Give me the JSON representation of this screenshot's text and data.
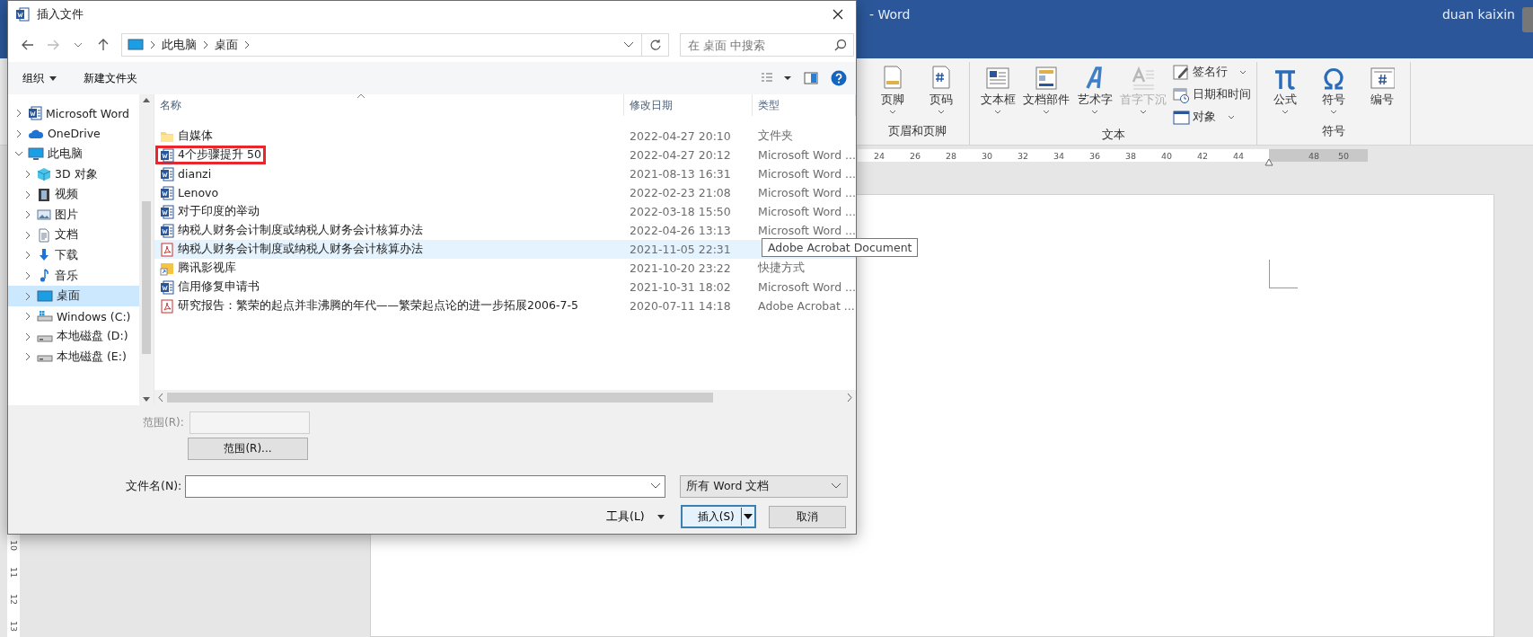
{
  "word_window": {
    "title": "-  Word",
    "user": "duan kaixin",
    "ribbon": {
      "groups": [
        {
          "label": "页眉和页脚",
          "items": [
            {
              "label": "页脚",
              "dropdown": true,
              "disabled": false
            },
            {
              "label": "页码",
              "dropdown": true,
              "disabled": false
            }
          ]
        },
        {
          "label": "文本",
          "items": [
            {
              "label": "文本框",
              "dropdown": true,
              "disabled": false
            },
            {
              "label": "文档部件",
              "dropdown": true,
              "disabled": false
            },
            {
              "label": "艺术字",
              "dropdown": true,
              "disabled": false
            },
            {
              "label": "首字下沉",
              "dropdown": true,
              "disabled": true
            }
          ],
          "small_items": [
            {
              "label": "签名行",
              "dropdown": true
            },
            {
              "label": "日期和时间",
              "dropdown": false
            },
            {
              "label": "对象",
              "dropdown": true
            }
          ]
        },
        {
          "label": "符号",
          "items": [
            {
              "label": "公式",
              "dropdown": true,
              "disabled": false
            },
            {
              "label": "符号",
              "dropdown": true,
              "disabled": false
            },
            {
              "label": "编号",
              "dropdown": false,
              "disabled": false
            }
          ]
        }
      ]
    },
    "ruler": {
      "left_ticks": [
        "24",
        "26",
        "28",
        "30",
        "32",
        "34",
        "36",
        "38",
        "40",
        "42",
        "44"
      ],
      "right_ticks": [
        "48",
        "50"
      ]
    },
    "vertical_ruler": [
      "10",
      "11",
      "12",
      "13"
    ]
  },
  "dialog": {
    "title": "插入文件",
    "breadcrumb": [
      "此电脑",
      "桌面"
    ],
    "search": {
      "placeholder": "在 桌面 中搜索"
    },
    "toolbar": [
      {
        "label": "组织",
        "dropdown": true
      },
      {
        "label": "新建文件夹",
        "dropdown": false
      }
    ],
    "sidebar": {
      "items": [
        {
          "label": "Microsoft Word",
          "expanded": false,
          "selected": false
        },
        {
          "label": "OneDrive",
          "expanded": false,
          "selected": false
        },
        {
          "label": "此电脑",
          "expanded": true,
          "selected": false,
          "children": [
            {
              "label": "3D 对象",
              "expanded": false,
              "selected": false
            },
            {
              "label": "视频",
              "expanded": false,
              "selected": false
            },
            {
              "label": "图片",
              "expanded": false,
              "selected": false
            },
            {
              "label": "文档",
              "expanded": false,
              "selected": false
            },
            {
              "label": "下载",
              "expanded": false,
              "selected": false
            },
            {
              "label": "音乐",
              "expanded": false,
              "selected": false
            },
            {
              "label": "桌面",
              "expanded": false,
              "selected": true
            },
            {
              "label": "Windows (C:)",
              "expanded": false,
              "selected": false
            },
            {
              "label": "本地磁盘 (D:)",
              "expanded": false,
              "selected": false
            },
            {
              "label": "本地磁盘 (E:)",
              "expanded": false,
              "selected": false
            }
          ]
        }
      ]
    },
    "table": {
      "columns": [
        "名称",
        "修改日期",
        "类型"
      ],
      "rows": [
        {
          "name": "自媒体",
          "date": "2022-04-27 20:10",
          "type": "文件夹",
          "kind": "folder",
          "hovered": false,
          "marked": false
        },
        {
          "name": "4个步骤提升 50",
          "date": "2022-04-27 20:12",
          "type": "Microsoft Word ...",
          "kind": "word",
          "hovered": false,
          "marked": true
        },
        {
          "name": "dianzi",
          "date": "2021-08-13 16:31",
          "type": "Microsoft Word ...",
          "kind": "word",
          "hovered": false,
          "marked": false
        },
        {
          "name": "Lenovo",
          "date": "2022-02-23 21:08",
          "type": "Microsoft Word ...",
          "kind": "word",
          "hovered": false,
          "marked": false
        },
        {
          "name": "对于印度的举动",
          "date": "2022-03-18 15:50",
          "type": "Microsoft Word ...",
          "kind": "word",
          "hovered": false,
          "marked": false
        },
        {
          "name": "纳税人财务会计制度或纳税人财务会计核算办法",
          "date": "2022-04-26 13:13",
          "type": "Microsoft Word ...",
          "kind": "word",
          "hovered": false,
          "marked": false
        },
        {
          "name": "纳税人财务会计制度或纳税人财务会计核算办法",
          "date": "2021-11-05 22:31",
          "kind": "pdf",
          "hovered": true,
          "marked": false
        },
        {
          "name": "腾讯影视库",
          "date": "2021-10-20 23:22",
          "type": "快捷方式",
          "kind": "shortcut",
          "hovered": false,
          "marked": false
        },
        {
          "name": "信用修复申请书",
          "date": "2021-10-31 18:02",
          "type": "Microsoft Word ...",
          "kind": "word",
          "hovered": false,
          "marked": false
        },
        {
          "name": "研究报告：繁荣的起点并非沸腾的年代——繁荣起点论的进一步拓展2006-7-5",
          "date": "2020-07-11 14:18",
          "type": "Adobe Acrobat ...",
          "kind": "pdf",
          "hovered": false,
          "marked": false
        }
      ]
    },
    "tooltip": "Adobe Acrobat Document",
    "range_label": "范围(R):",
    "range_button": "范围(R)...",
    "filename_label": "文件名(N):",
    "filter": "所有 Word 文档",
    "tools": "工具(L)",
    "insert": "插入(S)",
    "cancel": "取消"
  }
}
